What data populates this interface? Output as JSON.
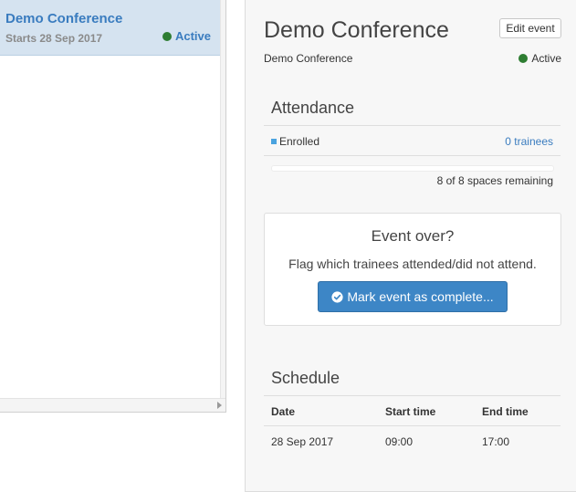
{
  "event_list": {
    "items": [
      {
        "title": "Demo Conference",
        "starts": "Starts 28 Sep 2017",
        "status": "Active"
      }
    ]
  },
  "detail": {
    "title": "Demo Conference",
    "edit_button": "Edit event",
    "subtitle": "Demo Conference",
    "status": "Active"
  },
  "attendance": {
    "heading": "Attendance",
    "enrolled_label": "Enrolled",
    "enrolled_value": "0 trainees",
    "spaces_remaining": "8 of 8 spaces remaining",
    "fill_fraction": 0
  },
  "event_over": {
    "title": "Event over?",
    "description": "Flag which trainees attended/did not attend.",
    "button_label": "Mark event as complete..."
  },
  "schedule": {
    "heading": "Schedule",
    "columns": [
      "Date",
      "Start time",
      "End time"
    ],
    "rows": [
      [
        "28 Sep 2017",
        "09:00",
        "17:00"
      ]
    ]
  },
  "colors": {
    "accent": "#3d86c6",
    "link": "#3a7cbf",
    "active_dot": "#2e7d32",
    "enrolled_marker": "#4aa3df"
  }
}
